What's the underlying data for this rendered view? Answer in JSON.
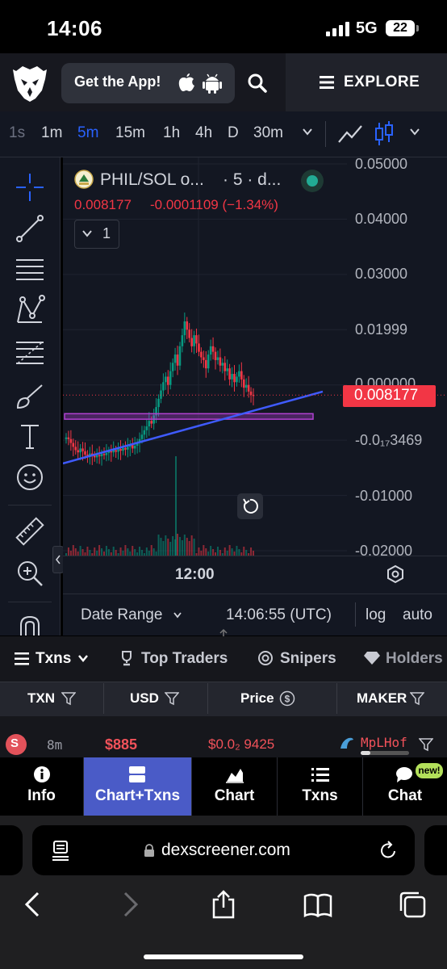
{
  "status_bar": {
    "time": "14:06",
    "network": "5G",
    "battery": "22"
  },
  "header": {
    "get_app_label": "Get the App!",
    "explore_label": "EXPLORE"
  },
  "timeframes": {
    "items": [
      "1s",
      "1m",
      "5m",
      "15m",
      "1h",
      "4h",
      "D",
      "30m"
    ],
    "active": "5m"
  },
  "chart": {
    "symbol": "PHIL/SOL o...",
    "interval": "· 5 · d...",
    "last_price": "0.008177",
    "change": "-0.0001109 (−1.34%)",
    "indicators_count": "1",
    "y_ticks": [
      "0.05000",
      "0.04000",
      "0.03000",
      "0.01999",
      "0.000000",
      "-0.0₁₇3469",
      "-0.01000",
      "-0.02000"
    ],
    "price_tag": "0.008177",
    "time_label": "12:00",
    "date_range_label": "Date Range",
    "utc_clock": "14:06:55 (UTC)",
    "log_label": "log",
    "auto_label": "auto",
    "up_color": "#089981",
    "down_color": "#f23645",
    "trendline_color": "#3f5bff",
    "zone_color": "#b040d0",
    "close_prices": [
      0.0005,
      0.0002,
      -0.0005,
      -0.0012,
      -0.0018,
      -0.0022,
      -0.0015,
      -0.002,
      -0.0026,
      -0.003,
      -0.0024,
      -0.0028,
      -0.0031,
      -0.0027,
      -0.0029,
      -0.0025,
      -0.0027,
      -0.0023,
      -0.002,
      -0.0022,
      -0.0018,
      -0.0021,
      -0.0016,
      -0.0019,
      -0.0014,
      -0.0017,
      -0.0012,
      -0.0008,
      -0.0015,
      -0.001,
      -0.0005,
      0.0002,
      0.001,
      0.0018,
      0.0025,
      0.0035,
      0.003,
      0.0045,
      0.006,
      0.0075,
      0.009,
      0.0105,
      0.0115,
      0.01,
      0.0125,
      0.014,
      0.0155,
      0.0135,
      0.017,
      0.019,
      0.0215,
      0.02,
      0.0185,
      0.017,
      0.019,
      0.0175,
      0.016,
      0.015,
      0.0145,
      0.013,
      0.0155,
      0.017,
      0.016,
      0.0145,
      0.015,
      0.0135,
      0.014,
      0.0125,
      0.013,
      0.011,
      0.012,
      0.0105,
      0.0115,
      0.0125,
      0.011,
      0.0095,
      0.01,
      0.0088,
      0.0082,
      0.008
    ]
  },
  "txn_tabs": {
    "txns": "Txns",
    "top_traders": "Top Traders",
    "snipers": "Snipers",
    "holders": "Holders"
  },
  "table": {
    "headers": {
      "txn": "TXN",
      "usd": "USD",
      "price": "Price",
      "maker": "MAKER"
    },
    "row": {
      "type": "S",
      "age": "8m",
      "usd": "$885",
      "price": "$0.0₂ 9425",
      "maker": "MpLHof"
    }
  },
  "bottom_nav": {
    "info": "Info",
    "chart_txns": "Chart+Txns",
    "chart": "Chart",
    "txns": "Txns",
    "chat": "Chat",
    "new_badge": "new!"
  },
  "browser": {
    "url": "dexscreener.com"
  }
}
